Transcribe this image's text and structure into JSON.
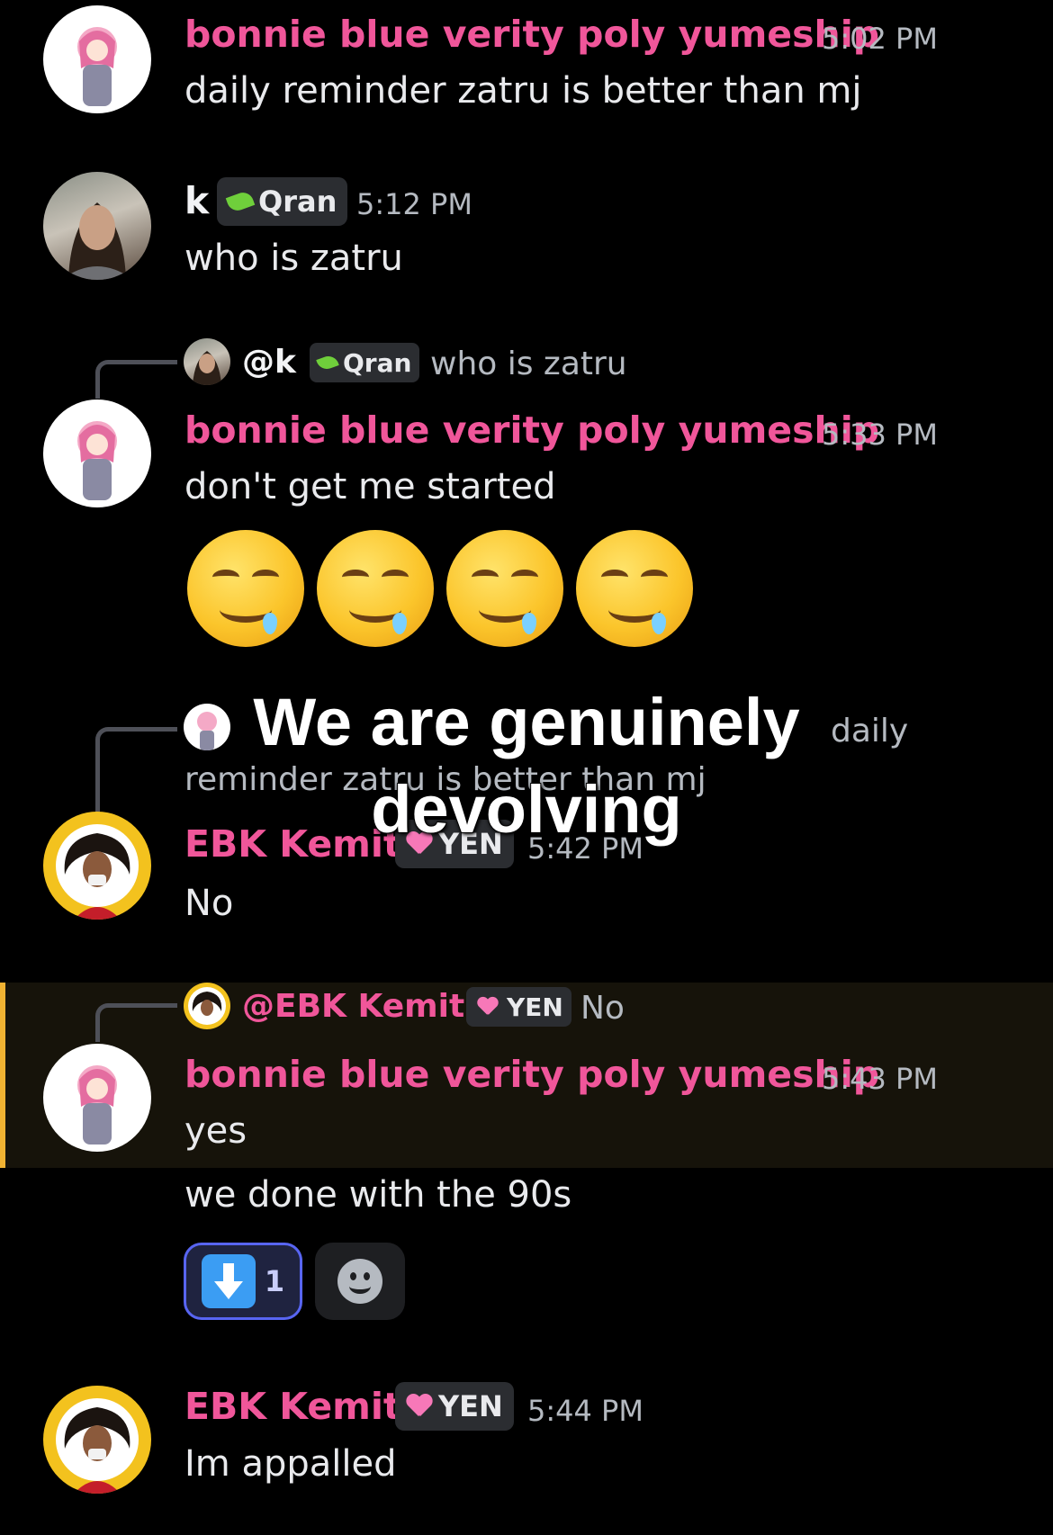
{
  "messages": [
    {
      "author": "bonnie blue verity poly yumeship",
      "time": "5:02 PM",
      "text": "daily reminder zatru is better than mj"
    },
    {
      "author": "k",
      "tag": "Qran",
      "time": "5:12 PM",
      "text": "who is zatru"
    },
    {
      "reply": {
        "author": "@k",
        "tag": "Qran",
        "text": "who is zatru"
      },
      "author": "bonnie blue verity poly yumeship",
      "time": "5:33 PM",
      "text": "don't get me started",
      "emoji": [
        "drooling-face",
        "drooling-face",
        "drooling-face",
        "drooling-face"
      ]
    },
    {
      "reply": {
        "text_end": "daily",
        "text_line2": "reminder zatru is better than mj"
      },
      "author": "EBK Kemit",
      "tag": "YEN",
      "time": "5:42 PM",
      "text": "No"
    },
    {
      "reply": {
        "author": "@EBK Kemit",
        "tag": "YEN",
        "text": "No"
      },
      "author": "bonnie blue verity poly yumeship",
      "time": "5:43 PM",
      "text": "yes",
      "text2": "we done with the 90s",
      "reactions": [
        {
          "emoji": "down-arrow",
          "count": "1"
        }
      ]
    },
    {
      "author": "EBK Kemit",
      "tag": "YEN",
      "time": "5:44 PM",
      "text": "Im appalled"
    }
  ],
  "overlay": {
    "line1": "We are genuinely",
    "line2": "devolving"
  },
  "colors": {
    "background": "#000000",
    "pink_name": "#f0569a",
    "highlight_bar": "#f0b232",
    "reaction_border": "#5865f2"
  }
}
